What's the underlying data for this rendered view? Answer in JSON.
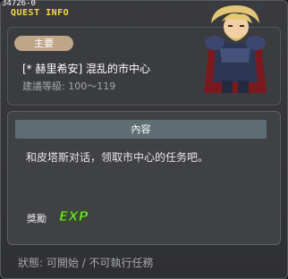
{
  "window": {
    "quest_id": "34726-0",
    "title": "QUEST INFO"
  },
  "quest": {
    "category": "主要",
    "name": "[* 赫里希安] 混乱的市中心",
    "level": "建議等級: 100～119"
  },
  "content": {
    "header": "內容",
    "text": "和皮塔斯对话，领取市中心的任务吧。"
  },
  "reward": {
    "label": "獎勵",
    "exp_text": "EXP"
  },
  "status": {
    "text": "狀態: 可開始 / 不可執行任務"
  },
  "colors": {
    "title": "#f6d94a",
    "badge": "#bfa58a",
    "content_header": "#5f6e73",
    "exp_green": "#7ce43a"
  }
}
